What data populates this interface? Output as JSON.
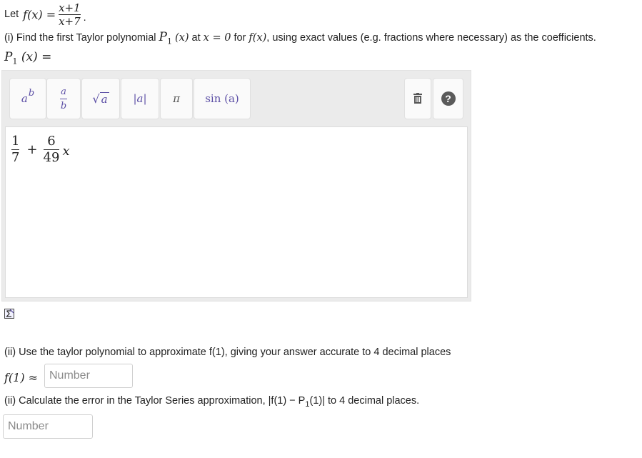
{
  "definition": {
    "let_text": "Let",
    "lhs": "f(x) =",
    "numerator": "x+1",
    "denominator": "x+7",
    "trailing": "."
  },
  "part1": {
    "prompt_start": "(i) Find the first Taylor polynomial",
    "polynomial": "P",
    "subscript": "1",
    "arg": "(x)",
    "at_text": "at",
    "point": "x = 0",
    "for_text": "for",
    "func": "f(x)",
    "prompt_end": ", using exact values (e.g. fractions where necessary) as the coefficients.",
    "answer_label": "(x) ="
  },
  "toolbar": {
    "power": {
      "base": "a",
      "exp": "b"
    },
    "fraction": {
      "num": "a",
      "den": "b"
    },
    "sqrt": {
      "symbol": "√",
      "arg": "a"
    },
    "abs": "|a|",
    "pi": "π",
    "sin": "sin (a)",
    "help": "?"
  },
  "answer": {
    "term1_num": "1",
    "term1_den": "7",
    "operator": "+",
    "term2_num": "6",
    "term2_den": "49",
    "variable": "x"
  },
  "part2": {
    "prompt": "(ii) Use the taylor polynomial to approximate f(1), giving your answer accurate to 4 decimal places",
    "label": "f(1) ≈",
    "placeholder": "Number"
  },
  "part3": {
    "prompt": "(ii) Calculate the error in the Taylor Series approximation, |f(1) − P",
    "subscript": "1",
    "prompt_end": "(1)| to 4 decimal places.",
    "placeholder": "Number"
  },
  "colors": {
    "toolbar_symbol": "#5b4ea5",
    "panel_bg": "#ebebeb",
    "help_icon": "#5a5a5a"
  },
  "icons": {
    "trash": "trash-icon",
    "help": "help-icon",
    "sigma": "sigma-icon"
  }
}
